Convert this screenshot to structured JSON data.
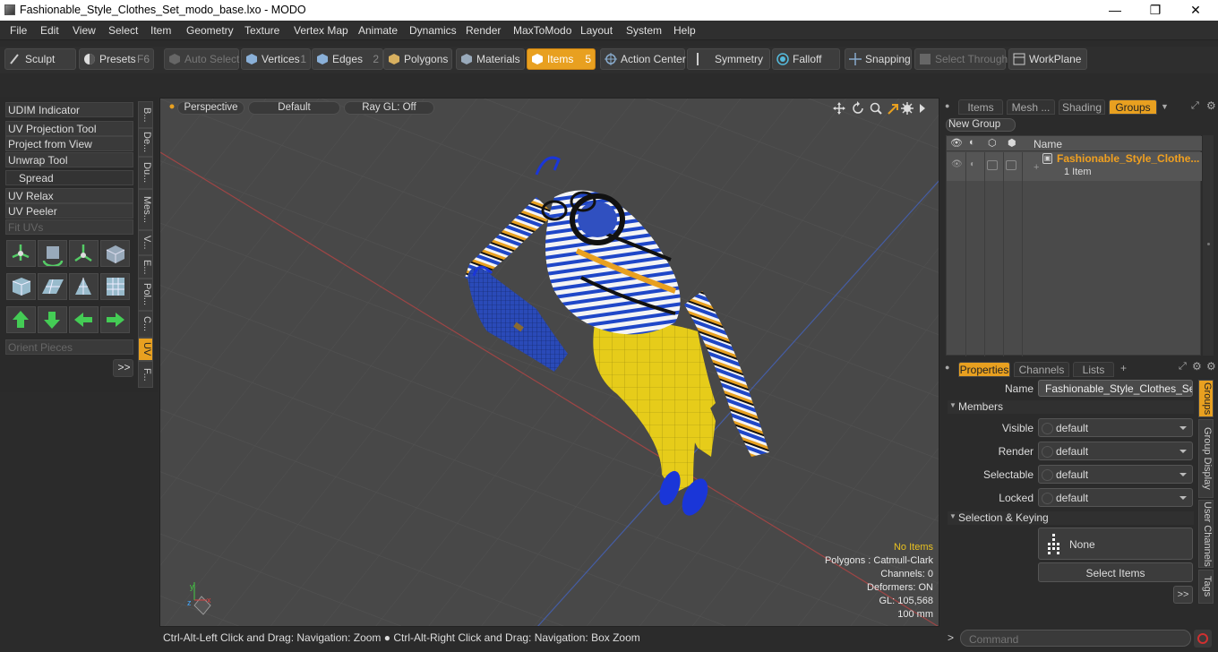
{
  "window": {
    "title": "Fashionable_Style_Clothes_Set_modo_base.lxo - MODO",
    "minimize": "—",
    "maximize": "❐",
    "close": "✕"
  },
  "menu": [
    "File",
    "Edit",
    "View",
    "Select",
    "Item",
    "Geometry",
    "Texture",
    "Vertex Map",
    "Animate",
    "Dynamics",
    "Render",
    "MaxToModo",
    "Layout",
    "System",
    "Help"
  ],
  "toolbar": {
    "sculpt": "Sculpt",
    "presets": "Presets",
    "presets_key": "F6",
    "auto_select": "Auto Select",
    "vertices": "Vertices",
    "vertices_num": "1",
    "edges": "Edges",
    "edges_num": "2",
    "polygons": "Polygons",
    "materials": "Materials",
    "items": "Items",
    "items_num": "5",
    "action_center": "Action Center",
    "symmetry": "Symmetry",
    "falloff": "Falloff",
    "snapping": "Snapping",
    "select_through": "Select Through",
    "workplane": "WorkPlane"
  },
  "left_panel": {
    "buttons": [
      "UDIM Indicator",
      "UV Projection Tool",
      "Project from View",
      "Unwrap Tool",
      "Spread",
      "UV Relax",
      "UV Peeler",
      "Fit UVs",
      "Orient Pieces"
    ],
    "vtabs": [
      "B...",
      "De...",
      "Du...",
      "Mes...",
      "V...",
      "E...",
      "Pol...",
      "C...",
      "UV",
      "F..."
    ],
    "more": ">>"
  },
  "viewport": {
    "view": "Perspective",
    "shading": "Default",
    "raygl": "Ray GL: Off",
    "stats": {
      "no_items": "No Items",
      "polygons": "Polygons : Catmull-Clark",
      "channels": "Channels: 0",
      "deformers": "Deformers: ON",
      "gl": "GL: 105,568",
      "scale": "100 mm"
    }
  },
  "right_top": {
    "tabs": [
      "Items",
      "Mesh ...",
      "Shading",
      "Groups"
    ],
    "new_group": "New Group",
    "col_name": "Name",
    "group_name": "Fashionable_Style_Clothe...",
    "group_count": "1 Item"
  },
  "properties": {
    "tabs": [
      "Properties",
      "Channels",
      "Lists",
      "+"
    ],
    "name_label": "Name",
    "name_value": "Fashionable_Style_Clothes_Set (:",
    "members_header": "Members",
    "visible_label": "Visible",
    "visible_value": "default",
    "render_label": "Render",
    "render_value": "default",
    "selectable_label": "Selectable",
    "selectable_value": "default",
    "locked_label": "Locked",
    "locked_value": "default",
    "keying_header": "Selection & Keying",
    "none_label": "None",
    "select_items": "Select Items",
    "more": ">>",
    "side_tabs": [
      "Groups",
      "Group Display",
      "User Channels",
      "Tags"
    ]
  },
  "status": {
    "hint": "Ctrl-Alt-Left Click and Drag: Navigation: Zoom ● Ctrl-Alt-Right Click and Drag: Navigation: Box Zoom",
    "command_placeholder": "Command",
    "prompt": ">"
  },
  "colors": {
    "accent": "#e8a020",
    "stripe_blue": "#1f47c8",
    "pants": "#e6cc1a"
  }
}
